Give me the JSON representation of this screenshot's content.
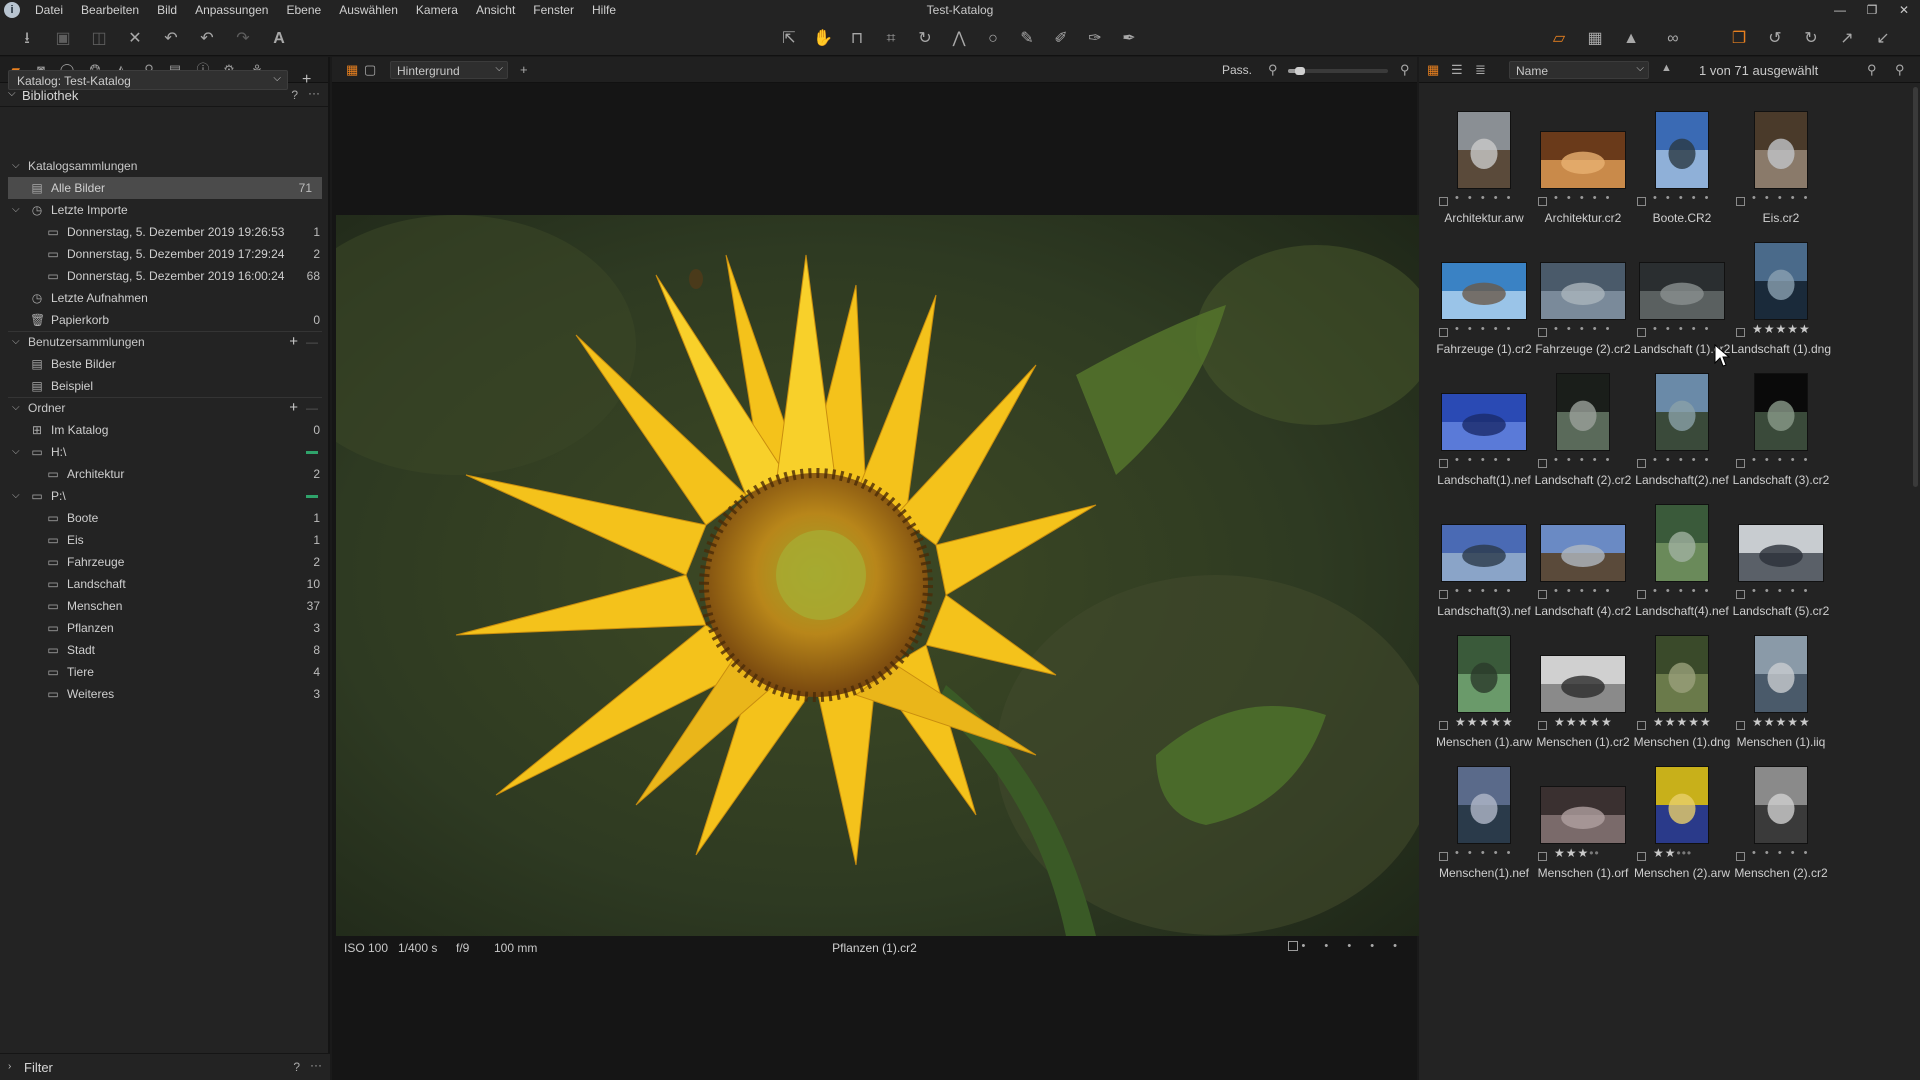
{
  "window": {
    "title": "Test-Katalog",
    "controls": [
      "—",
      "❐",
      "✕"
    ]
  },
  "menu": [
    "Datei",
    "Bearbeiten",
    "Bild",
    "Anpassungen",
    "Ebene",
    "Auswählen",
    "Kamera",
    "Ansicht",
    "Fenster",
    "Hilfe"
  ],
  "library": {
    "title": "Bibliothek",
    "help": "?",
    "more": "···",
    "catalog": "Katalog: Test-Katalog",
    "sections": {
      "catalog_collections": "Katalogsammlungen",
      "user_collections": "Benutzersammlungen",
      "folders": "Ordner"
    },
    "all_images": {
      "label": "Alle Bilder",
      "count": "71"
    },
    "recent_imports": {
      "label": "Letzte Importe",
      "items": [
        {
          "label": "Donnerstag, 5. Dezember 2019 19:26:53",
          "count": "1"
        },
        {
          "label": "Donnerstag, 5. Dezember 2019 17:29:24",
          "count": "2"
        },
        {
          "label": "Donnerstag, 5. Dezember 2019 16:00:24",
          "count": "68"
        }
      ]
    },
    "recent_captures": {
      "label": "Letzte Aufnahmen"
    },
    "trash": {
      "label": "Papierkorb",
      "count": "0"
    },
    "user_items": [
      {
        "label": "Beste Bilder"
      },
      {
        "label": "Beispiel"
      }
    ],
    "in_catalog": {
      "label": "Im Katalog",
      "count": "0"
    },
    "drive_h": {
      "label": "H:\\",
      "children": [
        {
          "label": "Architektur",
          "count": "2"
        }
      ]
    },
    "drive_p": {
      "label": "P:\\",
      "children": [
        {
          "label": "Boote",
          "count": "1"
        },
        {
          "label": "Eis",
          "count": "1"
        },
        {
          "label": "Fahrzeuge",
          "count": "2"
        },
        {
          "label": "Landschaft",
          "count": "10"
        },
        {
          "label": "Menschen",
          "count": "37"
        },
        {
          "label": "Pflanzen",
          "count": "3"
        },
        {
          "label": "Stadt",
          "count": "8"
        },
        {
          "label": "Tiere",
          "count": "4"
        },
        {
          "label": "Weiteres",
          "count": "3"
        }
      ]
    }
  },
  "filter": {
    "title": "Filter",
    "help": "?",
    "more": "···"
  },
  "viewer": {
    "background_select": "Hintergrund",
    "fit_label": "Pass.",
    "zoom_level": 0.12,
    "exif": {
      "iso": "ISO 100",
      "shutter": "1/400 s",
      "aperture": "f/9",
      "focal": "100 mm"
    },
    "filename": "Pflanzen (1).cr2",
    "rating_dots": "• • • • •"
  },
  "browser": {
    "sort": "Name",
    "selection": "1 von 71 ausgewählt",
    "thumbnails": [
      {
        "name": "Architektur.arw",
        "rating": 0
      },
      {
        "name": "Architektur.cr2",
        "rating": 0
      },
      {
        "name": "Boote.CR2",
        "rating": 0
      },
      {
        "name": "Eis.cr2",
        "rating": 0
      },
      {
        "name": "Fahrzeuge (1).cr2",
        "rating": 0
      },
      {
        "name": "Fahrzeuge (2).cr2",
        "rating": 0
      },
      {
        "name": "Landschaft (1).cr2",
        "rating": 0
      },
      {
        "name": "Landschaft (1).dng",
        "rating": 5
      },
      {
        "name": "Landschaft(1).nef",
        "rating": 0
      },
      {
        "name": "Landschaft (2).cr2",
        "rating": 0
      },
      {
        "name": "Landschaft(2).nef",
        "rating": 0
      },
      {
        "name": "Landschaft (3).cr2",
        "rating": 0
      },
      {
        "name": "Landschaft(3).nef",
        "rating": 0
      },
      {
        "name": "Landschaft (4).cr2",
        "rating": 0
      },
      {
        "name": "Landschaft(4).nef",
        "rating": 0
      },
      {
        "name": "Landschaft (5).cr2",
        "rating": 0
      },
      {
        "name": "Menschen (1).arw",
        "rating": 5
      },
      {
        "name": "Menschen (1).cr2",
        "rating": 5
      },
      {
        "name": "Menschen (1).dng",
        "rating": 5
      },
      {
        "name": "Menschen (1).iiq",
        "rating": 5
      },
      {
        "name": "Menschen(1).nef",
        "rating": 0
      },
      {
        "name": "Menschen (1).orf",
        "rating": 3
      },
      {
        "name": "Menschen (2).arw",
        "rating": 2
      },
      {
        "name": "Menschen (2).cr2",
        "rating": 0
      }
    ]
  },
  "colors": {
    "accent": "#e8801f",
    "selection": "#4b4b4b",
    "online": "#2fa36b",
    "panel": "#232323"
  }
}
